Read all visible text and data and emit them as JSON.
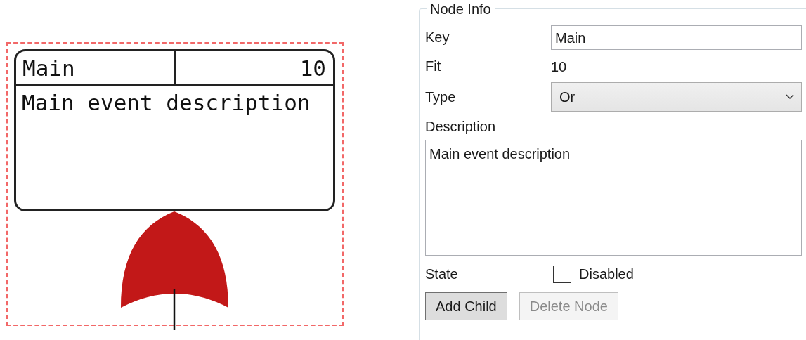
{
  "diagram": {
    "node": {
      "key": "Main",
      "fit": "10",
      "description": "Main event description",
      "selected": true,
      "gate": {
        "kind": "or"
      }
    }
  },
  "node_info": {
    "title": "Node Info",
    "fields": [
      {
        "kind": "text",
        "label": "Key",
        "value": "Main"
      },
      {
        "kind": "value",
        "label": "Fit",
        "value": "10"
      },
      {
        "kind": "select",
        "label": "Type",
        "value": "Or"
      },
      {
        "kind": "textarea",
        "label": "Description",
        "value": "Main event description"
      },
      {
        "kind": "checkbox",
        "label": "State",
        "option": "Disabled",
        "checked": false
      }
    ],
    "buttons": [
      {
        "label": "Add Child",
        "disabled": false
      },
      {
        "label": "Delete Node",
        "disabled": true
      }
    ]
  }
}
